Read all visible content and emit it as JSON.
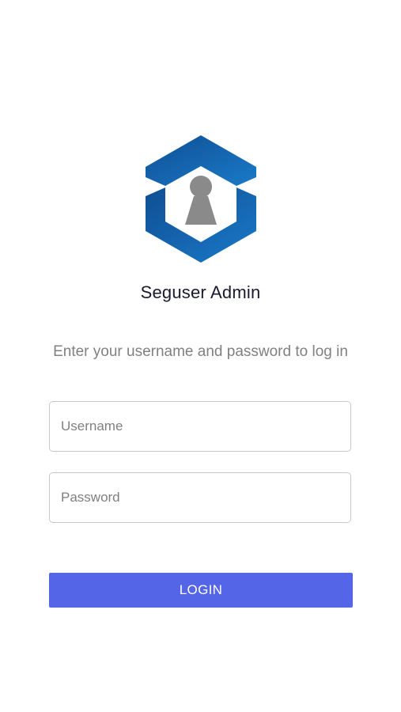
{
  "app": {
    "title": "Seguser Admin",
    "logo_icon": "shield-user-icon"
  },
  "login": {
    "instructions": "Enter your username and password to log in",
    "username_placeholder": "Username",
    "username_value": "",
    "password_placeholder": "Password",
    "password_value": "",
    "button_label": "LOGIN"
  },
  "colors": {
    "brand_blue": "#1565b0",
    "button_bg": "#5565e8",
    "avatar_gray": "#8a8a8a"
  }
}
